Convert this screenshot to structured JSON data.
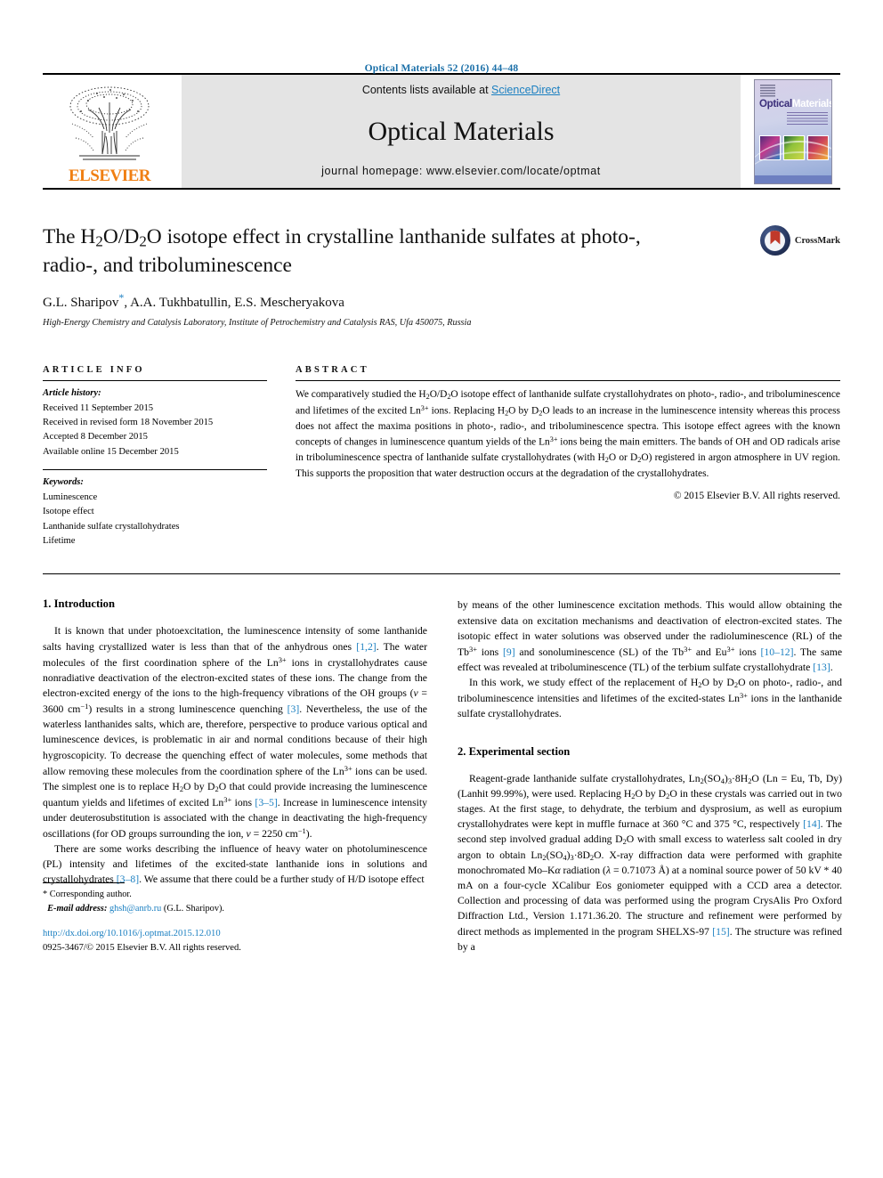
{
  "running_head": "Optical Materials 52 (2016) 44–48",
  "masthead": {
    "publisher": "ELSEVIER",
    "contents_prefix": "Contents lists available at ",
    "contents_link": "ScienceDirect",
    "journal_title": "Optical Materials",
    "homepage": "journal homepage: www.elsevier.com/locate/optmat",
    "cover_title_1": "Optical",
    "cover_title_2": "Materials"
  },
  "article": {
    "title": "The H2O/D2O isotope effect in crystalline lanthanide sulfates at photo-, radio-, and triboluminescence",
    "authors": "G.L. Sharipov",
    "authors_rest": ", A.A. Tukhbatullin, E.S. Mescheryakova",
    "affiliation": "High-Energy Chemistry and Catalysis Laboratory, Institute of Petrochemistry and Catalysis RAS, Ufa 450075, Russia",
    "crossmark_label": "CrossMark"
  },
  "article_info": {
    "heading": "ARTICLE INFO",
    "history_label": "Article history:",
    "history": [
      "Received 11 September 2015",
      "Received in revised form 18 November 2015",
      "Accepted 8 December 2015",
      "Available online 15 December 2015"
    ],
    "keywords_label": "Keywords:",
    "keywords": [
      "Luminescence",
      "Isotope effect",
      "Lanthanide sulfate crystallohydrates",
      "Lifetime"
    ]
  },
  "abstract": {
    "heading": "ABSTRACT",
    "copyright": "© 2015 Elsevier B.V. All rights reserved."
  },
  "sections": {
    "intro_heading": "1. Introduction",
    "experimental_heading": "2. Experimental section"
  },
  "footnote": {
    "corresponding": "* Corresponding author.",
    "email_label": "E-mail address:",
    "email": "ghsh@anrb.ru",
    "email_suffix": " (G.L. Sharipov).",
    "doi": "http://dx.doi.org/10.1016/j.optmat.2015.12.010",
    "issn_line": "0925-3467/© 2015 Elsevier B.V. All rights reserved."
  },
  "colors": {
    "link": "#1a7fc1",
    "elsevier_orange": "#f07f13",
    "header_blue": "#1a6fa8"
  }
}
